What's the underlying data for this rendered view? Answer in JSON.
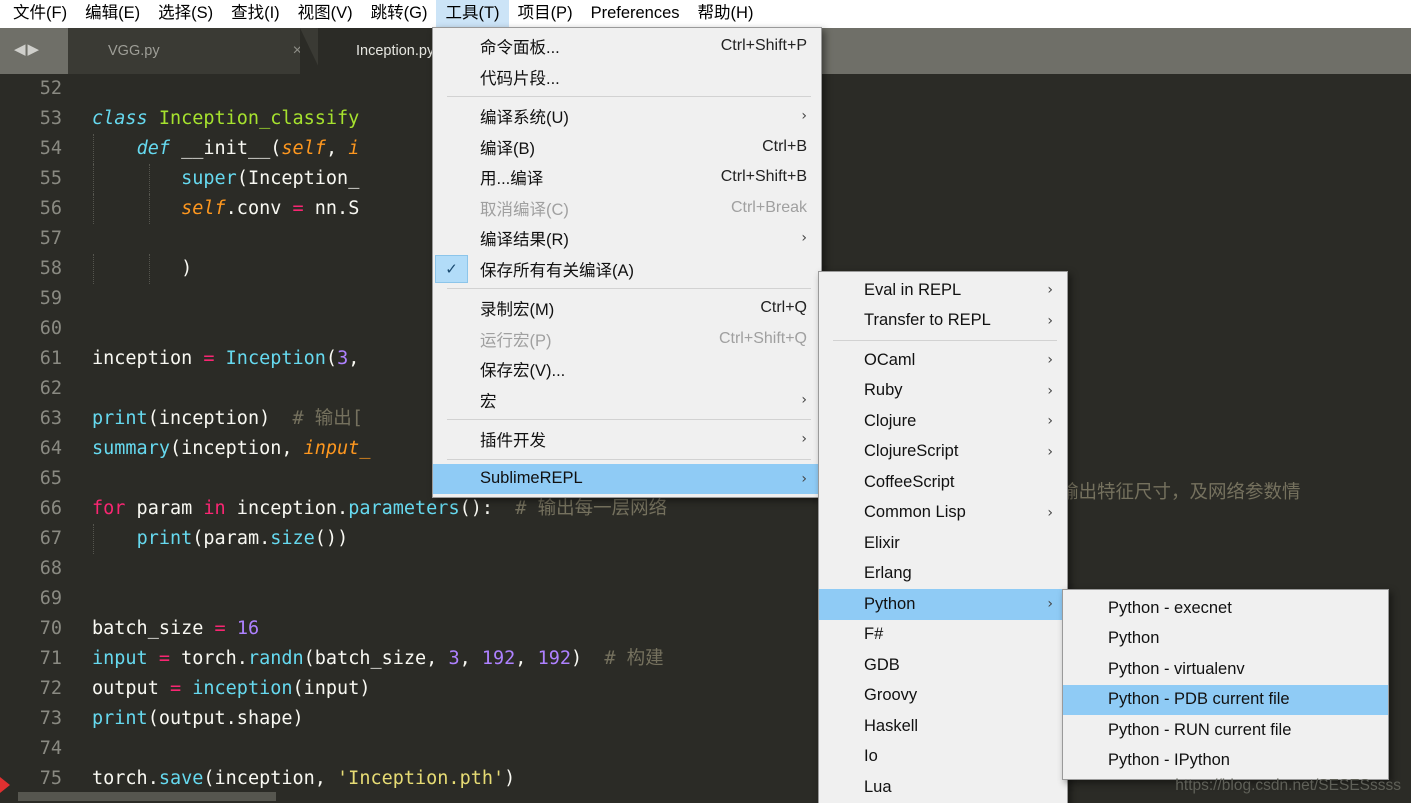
{
  "menubar": {
    "items": [
      {
        "label": "文件(F)",
        "active": false
      },
      {
        "label": "编辑(E)",
        "active": false
      },
      {
        "label": "选择(S)",
        "active": false
      },
      {
        "label": "查找(I)",
        "active": false
      },
      {
        "label": "视图(V)",
        "active": false
      },
      {
        "label": "跳转(G)",
        "active": false
      },
      {
        "label": "工具(T)",
        "active": true
      },
      {
        "label": "项目(P)",
        "active": false
      },
      {
        "label": "Preferences",
        "active": false
      },
      {
        "label": "帮助(H)",
        "active": false
      }
    ]
  },
  "tabs": {
    "nav_prev": "◀",
    "nav_next": "▶",
    "items": [
      {
        "label": "VGG.py",
        "close": "×",
        "active": false
      },
      {
        "label": "Inception.py",
        "close": "",
        "active": true
      }
    ]
  },
  "code": {
    "lines": [
      {
        "n": "52",
        "tokens": []
      },
      {
        "n": "53",
        "tokens": [
          {
            "t": "class ",
            "c": "kw2"
          },
          {
            "t": "Inception_classify",
            "c": "fn"
          }
        ]
      },
      {
        "n": "54",
        "tokens": [
          {
            "t": "    ",
            "c": "plain"
          },
          {
            "t": "def ",
            "c": "kw2"
          },
          {
            "t": "__init__",
            "c": "plain"
          },
          {
            "t": "(",
            "c": "plain"
          },
          {
            "t": "self",
            "c": "self"
          },
          {
            "t": ", ",
            "c": "plain"
          },
          {
            "t": "i",
            "c": "self"
          }
        ]
      },
      {
        "n": "55",
        "tokens": [
          {
            "t": "        ",
            "c": "plain"
          },
          {
            "t": "super",
            "c": "builtin"
          },
          {
            "t": "(Inception_",
            "c": "plain"
          }
        ]
      },
      {
        "n": "56",
        "tokens": [
          {
            "t": "        ",
            "c": "plain"
          },
          {
            "t": "self",
            "c": "self"
          },
          {
            "t": ".conv ",
            "c": "plain"
          },
          {
            "t": "=",
            "c": "op"
          },
          {
            "t": " nn.S",
            "c": "plain"
          }
        ]
      },
      {
        "n": "57",
        "tokens": []
      },
      {
        "n": "58",
        "tokens": [
          {
            "t": "        )",
            "c": "plain"
          }
        ]
      },
      {
        "n": "59",
        "tokens": []
      },
      {
        "n": "60",
        "tokens": []
      },
      {
        "n": "61",
        "tokens": [
          {
            "t": "inception ",
            "c": "plain"
          },
          {
            "t": "=",
            "c": "op"
          },
          {
            "t": " ",
            "c": "plain"
          },
          {
            "t": "Inception",
            "c": "builtin"
          },
          {
            "t": "(",
            "c": "plain"
          },
          {
            "t": "3",
            "c": "num"
          },
          {
            "t": ",",
            "c": "plain"
          }
        ]
      },
      {
        "n": "62",
        "tokens": []
      },
      {
        "n": "63",
        "tokens": [
          {
            "t": "print",
            "c": "builtin"
          },
          {
            "t": "(inception)  ",
            "c": "plain"
          },
          {
            "t": "# 输出[",
            "c": "com"
          }
        ]
      },
      {
        "n": "64",
        "tokens": [
          {
            "t": "summary",
            "c": "builtin"
          },
          {
            "t": "(inception, ",
            "c": "plain"
          },
          {
            "t": "input_",
            "c": "self"
          }
        ]
      },
      {
        "n": "65",
        "tokens": []
      },
      {
        "n": "66",
        "tokens": [
          {
            "t": "for",
            "c": "kw"
          },
          {
            "t": " param ",
            "c": "plain"
          },
          {
            "t": "in",
            "c": "kw"
          },
          {
            "t": " inception.",
            "c": "plain"
          },
          {
            "t": "parameters",
            "c": "builtin"
          },
          {
            "t": "():  ",
            "c": "plain"
          },
          {
            "t": "# 输出每一层网络",
            "c": "com"
          }
        ]
      },
      {
        "n": "67",
        "tokens": [
          {
            "t": "    ",
            "c": "plain"
          },
          {
            "t": "print",
            "c": "builtin"
          },
          {
            "t": "(param.",
            "c": "plain"
          },
          {
            "t": "size",
            "c": "builtin"
          },
          {
            "t": "())",
            "c": "plain"
          }
        ]
      },
      {
        "n": "68",
        "tokens": []
      },
      {
        "n": "69",
        "tokens": []
      },
      {
        "n": "70",
        "tokens": [
          {
            "t": "batch_size ",
            "c": "plain"
          },
          {
            "t": "=",
            "c": "op"
          },
          {
            "t": " ",
            "c": "plain"
          },
          {
            "t": "16",
            "c": "num"
          }
        ]
      },
      {
        "n": "71",
        "tokens": [
          {
            "t": "input ",
            "c": "builtin"
          },
          {
            "t": "=",
            "c": "op"
          },
          {
            "t": " torch.",
            "c": "plain"
          },
          {
            "t": "randn",
            "c": "builtin"
          },
          {
            "t": "(batch_size, ",
            "c": "plain"
          },
          {
            "t": "3",
            "c": "num"
          },
          {
            "t": ", ",
            "c": "plain"
          },
          {
            "t": "192",
            "c": "num"
          },
          {
            "t": ", ",
            "c": "plain"
          },
          {
            "t": "192",
            "c": "num"
          },
          {
            "t": ")  ",
            "c": "plain"
          },
          {
            "t": "# 构建",
            "c": "com"
          }
        ]
      },
      {
        "n": "72",
        "tokens": [
          {
            "t": "output ",
            "c": "plain"
          },
          {
            "t": "=",
            "c": "op"
          },
          {
            "t": " ",
            "c": "plain"
          },
          {
            "t": "inception",
            "c": "builtin"
          },
          {
            "t": "(input)",
            "c": "plain"
          }
        ]
      },
      {
        "n": "73",
        "tokens": [
          {
            "t": "print",
            "c": "builtin"
          },
          {
            "t": "(output.shape)",
            "c": "plain"
          }
        ]
      },
      {
        "n": "74",
        "tokens": []
      },
      {
        "n": "75",
        "tokens": [
          {
            "t": "torch.",
            "c": "plain"
          },
          {
            "t": "save",
            "c": "builtin"
          },
          {
            "t": "(inception, ",
            "c": "plain"
          },
          {
            "t": "'Inception.pth'",
            "c": "str"
          },
          {
            "t": ")",
            "c": "plain"
          }
        ]
      }
    ],
    "overflow_comment_line64": "输出特征尺寸，及网络参数情"
  },
  "tools_menu": {
    "rows": [
      {
        "label": "命令面板...",
        "accel": "Ctrl+Shift+P",
        "arrow": false,
        "disabled": false,
        "selected": false,
        "checked": false
      },
      {
        "label": "代码片段...",
        "accel": "",
        "arrow": false,
        "disabled": false,
        "selected": false,
        "checked": false
      },
      {
        "sep": true
      },
      {
        "label": "编译系统(U)",
        "accel": "",
        "arrow": true,
        "disabled": false,
        "selected": false,
        "checked": false
      },
      {
        "label": "编译(B)",
        "accel": "Ctrl+B",
        "arrow": false,
        "disabled": false,
        "selected": false,
        "checked": false
      },
      {
        "label": "用...编译",
        "accel": "Ctrl+Shift+B",
        "arrow": false,
        "disabled": false,
        "selected": false,
        "checked": false
      },
      {
        "label": "取消编译(C)",
        "accel": "Ctrl+Break",
        "arrow": false,
        "disabled": true,
        "selected": false,
        "checked": false
      },
      {
        "label": "编译结果(R)",
        "accel": "",
        "arrow": true,
        "disabled": false,
        "selected": false,
        "checked": false
      },
      {
        "label": "保存所有有关编译(A)",
        "accel": "",
        "arrow": false,
        "disabled": false,
        "selected": false,
        "checked": true
      },
      {
        "sep": true
      },
      {
        "label": "录制宏(M)",
        "accel": "Ctrl+Q",
        "arrow": false,
        "disabled": false,
        "selected": false,
        "checked": false
      },
      {
        "label": "运行宏(P)",
        "accel": "Ctrl+Shift+Q",
        "arrow": false,
        "disabled": true,
        "selected": false,
        "checked": false
      },
      {
        "label": "保存宏(V)...",
        "accel": "",
        "arrow": false,
        "disabled": false,
        "selected": false,
        "checked": false
      },
      {
        "label": "宏",
        "accel": "",
        "arrow": true,
        "disabled": false,
        "selected": false,
        "checked": false
      },
      {
        "sep": true
      },
      {
        "label": "插件开发",
        "accel": "",
        "arrow": true,
        "disabled": false,
        "selected": false,
        "checked": false
      },
      {
        "sep": true
      },
      {
        "label": "SublimeREPL",
        "accel": "",
        "arrow": true,
        "disabled": false,
        "selected": true,
        "checked": false
      }
    ]
  },
  "repl_menu": {
    "rows": [
      {
        "label": "Eval in REPL",
        "arrow": true,
        "selected": false
      },
      {
        "label": "Transfer to REPL",
        "arrow": true,
        "selected": false
      },
      {
        "sep": true
      },
      {
        "label": "OCaml",
        "arrow": true,
        "selected": false
      },
      {
        "label": "Ruby",
        "arrow": true,
        "selected": false
      },
      {
        "label": "Clojure",
        "arrow": true,
        "selected": false
      },
      {
        "label": "ClojureScript",
        "arrow": true,
        "selected": false
      },
      {
        "label": "CoffeeScript",
        "arrow": false,
        "selected": false
      },
      {
        "label": "Common Lisp",
        "arrow": true,
        "selected": false
      },
      {
        "label": "Elixir",
        "arrow": false,
        "selected": false
      },
      {
        "label": "Erlang",
        "arrow": false,
        "selected": false
      },
      {
        "label": "Python",
        "arrow": true,
        "selected": true
      },
      {
        "label": "F#",
        "arrow": false,
        "selected": false
      },
      {
        "label": "GDB",
        "arrow": false,
        "selected": false
      },
      {
        "label": "Groovy",
        "arrow": false,
        "selected": false
      },
      {
        "label": "Haskell",
        "arrow": false,
        "selected": false
      },
      {
        "label": "Io",
        "arrow": false,
        "selected": false
      },
      {
        "label": "Lua",
        "arrow": false,
        "selected": false
      }
    ]
  },
  "python_menu": {
    "rows": [
      {
        "label": "Python - execnet",
        "selected": false
      },
      {
        "label": "Python",
        "selected": false
      },
      {
        "label": "Python - virtualenv",
        "selected": false
      },
      {
        "label": "Python - PDB current file",
        "selected": true
      },
      {
        "label": "Python - RUN current file",
        "selected": false
      },
      {
        "label": "Python - IPython",
        "selected": false
      }
    ]
  },
  "watermark": {
    "text": "https://blog.csdn.net/SESESssss"
  },
  "colors": {
    "menu_highlight": "#8fcbf5",
    "menubar_active": "#cce4f7",
    "editor_bg": "#2b2b26",
    "tabbar_bg": "#6f6f68",
    "menu_bg": "#f0f0f0"
  }
}
